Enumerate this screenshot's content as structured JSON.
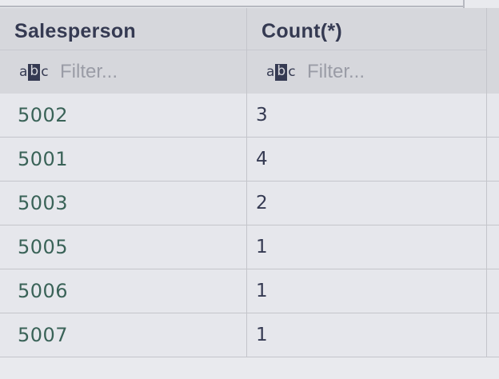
{
  "table": {
    "columns": [
      {
        "title": "Salesperson",
        "filter_placeholder": "Filter...",
        "filter_type_icon": "abc-text-type-icon"
      },
      {
        "title": "Count(*)",
        "filter_placeholder": "Filter...",
        "filter_type_icon": "abc-text-type-icon"
      }
    ],
    "type_icon": {
      "a": "a",
      "b": "b",
      "c": "c"
    },
    "rows": [
      {
        "salesperson": "5002",
        "count": "3"
      },
      {
        "salesperson": "5001",
        "count": "4"
      },
      {
        "salesperson": "5003",
        "count": "2"
      },
      {
        "salesperson": "5005",
        "count": "1"
      },
      {
        "salesperson": "5006",
        "count": "1"
      },
      {
        "salesperson": "5007",
        "count": "1"
      }
    ]
  },
  "colors": {
    "header_bg": "#d6d7dc",
    "row_bg": "#e6e7ec",
    "header_text": "#353a52",
    "id_text": "#3a6358",
    "grid_line": "#c4c5cb"
  }
}
